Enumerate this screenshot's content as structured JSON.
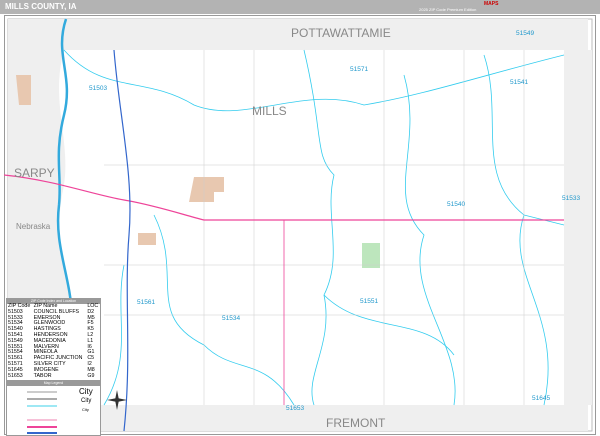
{
  "header": {
    "title": "MILLS COUNTY, IA",
    "edition": "2025 ZIP Code Premium Edition",
    "logo_text": "MAPS"
  },
  "map": {
    "counties": {
      "north": "POTTAWATTAMIE",
      "center": "MILLS",
      "west": "SARPY",
      "south": "FREMONT"
    },
    "state": "Nebraska",
    "zip_labels": [
      "51549",
      "51571",
      "51541",
      "51503",
      "51540",
      "51533",
      "51551",
      "51534",
      "51561",
      "51653",
      "51645"
    ],
    "colors": {
      "zip_boundary": "#33ccee",
      "highway": "#ee4499",
      "interstate": "#3366cc",
      "river": "#33aadd",
      "urban": "#e8c8b0"
    }
  },
  "legend": {
    "title": "ZIP Code Index and Location",
    "columns": [
      "ZIP Code",
      "ZIP Name",
      "LOC"
    ],
    "rows": [
      [
        "51503",
        "COUNCIL BLUFFS",
        "D2"
      ],
      [
        "51533",
        "EMERSON",
        "M5"
      ],
      [
        "51534",
        "GLENWOOD",
        "F5"
      ],
      [
        "51540",
        "HASTINGS",
        "K5"
      ],
      [
        "51541",
        "HENDERSON",
        "L2"
      ],
      [
        "51549",
        "MACEDONIA",
        "L1"
      ],
      [
        "51551",
        "MALVERN",
        "I6"
      ],
      [
        "51554",
        "MINEOLA",
        "G1"
      ],
      [
        "51561",
        "PACIFIC JUNCTION",
        "C5"
      ],
      [
        "51571",
        "SILVER CITY",
        "I2"
      ],
      [
        "51645",
        "IMOGENE",
        "M8"
      ],
      [
        "51653",
        "TABOR",
        "G9"
      ]
    ],
    "key_title": "Map Legend",
    "city_labels": [
      "City",
      "City",
      "City"
    ]
  }
}
